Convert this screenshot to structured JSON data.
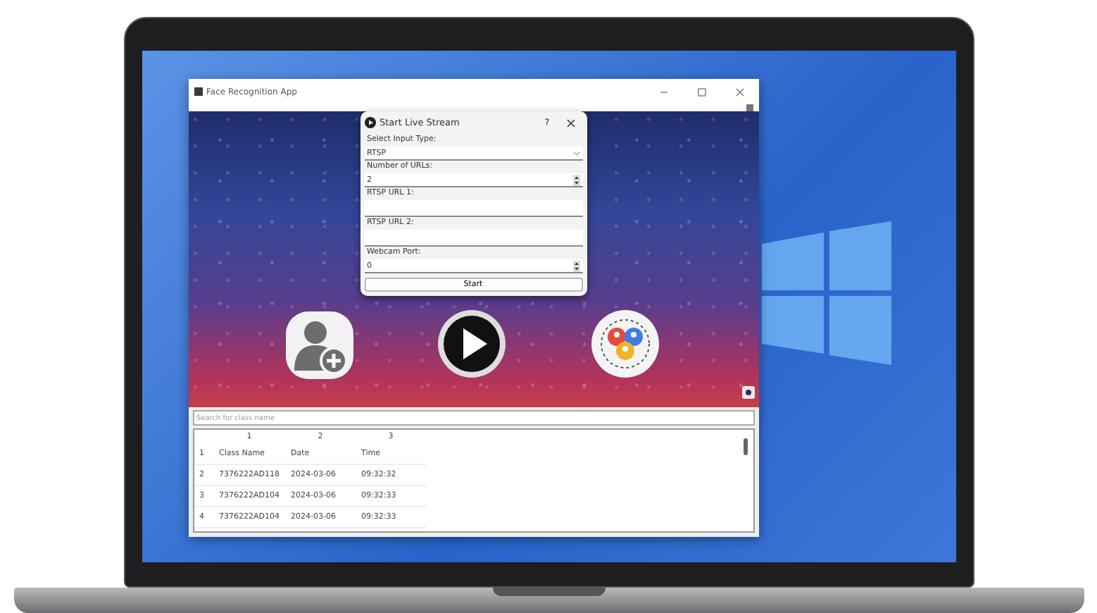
{
  "window": {
    "title": "Face Recognition App"
  },
  "dialog": {
    "title": "Start Live Stream",
    "help": "?",
    "fields": [
      {
        "kind": "dropdown",
        "label": "Select Input Type:",
        "value": "RTSP"
      },
      {
        "kind": "spinbox",
        "label": "Number of URLs:",
        "value": "2"
      },
      {
        "kind": "text",
        "label": "RTSP URL 1:"
      },
      {
        "kind": "text",
        "label": "RTSP URL 2:"
      },
      {
        "kind": "spinbox",
        "label": "Webcam Port:",
        "value": "0"
      }
    ],
    "button": "Start"
  },
  "search": {
    "placeholder": "Search for class name"
  },
  "table": {
    "columns": [
      "1",
      "2",
      "3"
    ],
    "rows": [
      {
        "header": "1",
        "cells": [
          "Class Name",
          "Date",
          "Time"
        ]
      },
      {
        "header": "2",
        "cells": [
          "7376222AD118",
          "2024-03-06",
          "09:32:32"
        ]
      },
      {
        "header": "3",
        "cells": [
          "7376222AD104",
          "2024-03-06",
          "09:32:33"
        ]
      },
      {
        "header": "4",
        "cells": [
          "7376222AD104",
          "2024-03-06",
          "09:32:33"
        ]
      }
    ]
  }
}
